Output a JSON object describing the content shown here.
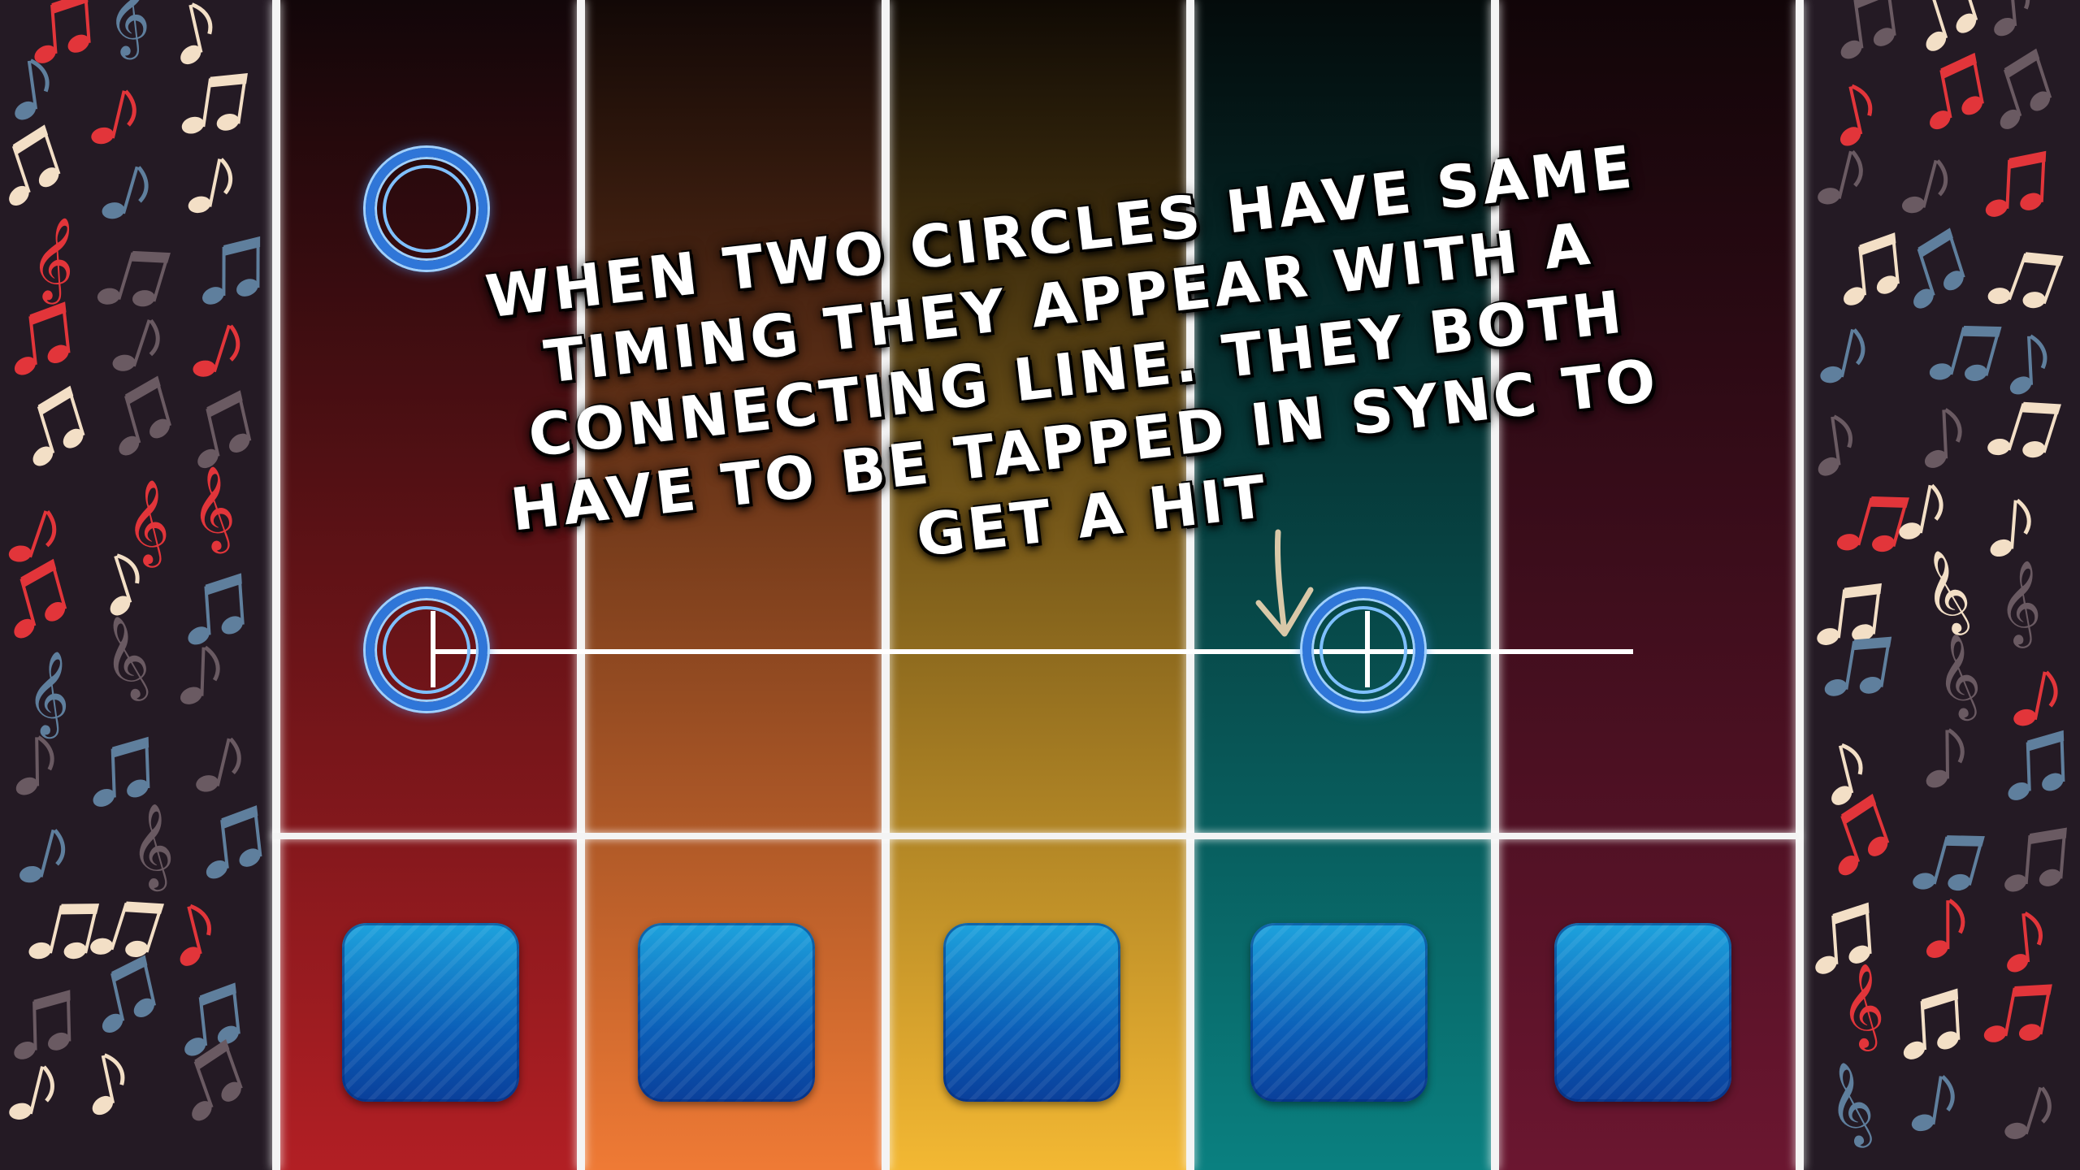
{
  "tutorial": {
    "text": "When two circles have same timing they appear with a connecting line. They both have to be tapped in sync to get a hit"
  },
  "lanes": [
    {
      "top_color": "#120609",
      "bottom_color": "#b21f24"
    },
    {
      "top_color": "#120806",
      "bottom_color": "#ef7a35"
    },
    {
      "top_color": "#100a04",
      "bottom_color": "#f3b833"
    },
    {
      "top_color": "#040b0b",
      "bottom_color": "#0a8080"
    },
    {
      "top_color": "#110508",
      "bottom_color": "#6b1630"
    }
  ],
  "colors": {
    "divider": "#f4f4f4",
    "pad": "#1ea3dd",
    "note_ring": "#2f76d8",
    "sidebar_bg": "#241a24",
    "note_red": "#e2353a",
    "note_cream": "#f3dfc6",
    "note_blue": "#5f7f9d",
    "note_gray": "#6a5a62"
  },
  "notes": [
    {
      "lane": 1,
      "type": "single-tap"
    },
    {
      "lane": 1,
      "type": "sync-tap",
      "linked_lane": 4
    }
  ],
  "icons": [
    "music-note-icon",
    "treble-clef-icon",
    "down-arrow-icon"
  ]
}
